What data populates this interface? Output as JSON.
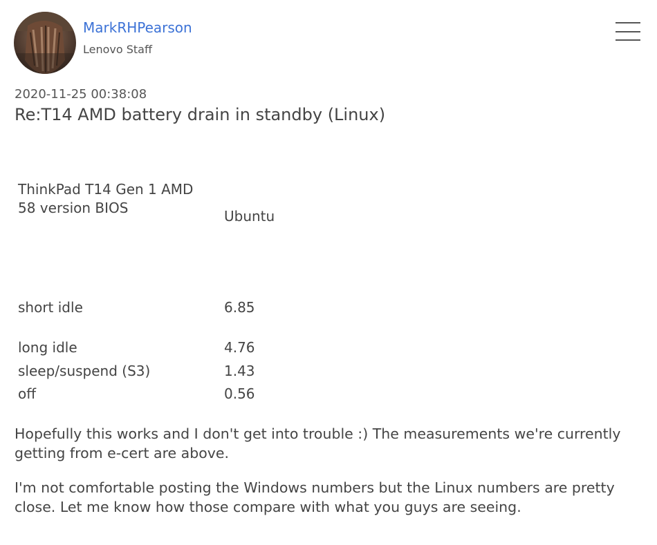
{
  "author": {
    "name": "MarkRHPearson",
    "rank": "Lenovo Staff"
  },
  "post": {
    "date": "2020-11-25 00:38:08",
    "title": "Re:T14 AMD battery drain in standby (Linux)",
    "specs": {
      "model": "ThinkPad T14 Gen 1 AMD",
      "bios": "58 version BIOS",
      "os": "Ubuntu"
    },
    "measurements": [
      {
        "label": "short idle",
        "value": "6.85"
      },
      {
        "label": "long idle",
        "value": "4.76"
      },
      {
        "label": "sleep/suspend (S3)",
        "value": "1.43"
      },
      {
        "label": "off",
        "value": "0.56"
      }
    ],
    "paragraphs": [
      "Hopefully this works and I don't get into trouble :) The measurements we're currently getting from e-cert are above.",
      "I'm not comfortable posting the Windows numbers but the Linux numbers are pretty close. Let me know how those compare with what you guys are seeing."
    ]
  },
  "icons": {
    "menu": "hamburger-menu-icon",
    "avatar": "user-avatar"
  },
  "colors": {
    "author_link": "#3c72d6",
    "text": "#444444"
  }
}
